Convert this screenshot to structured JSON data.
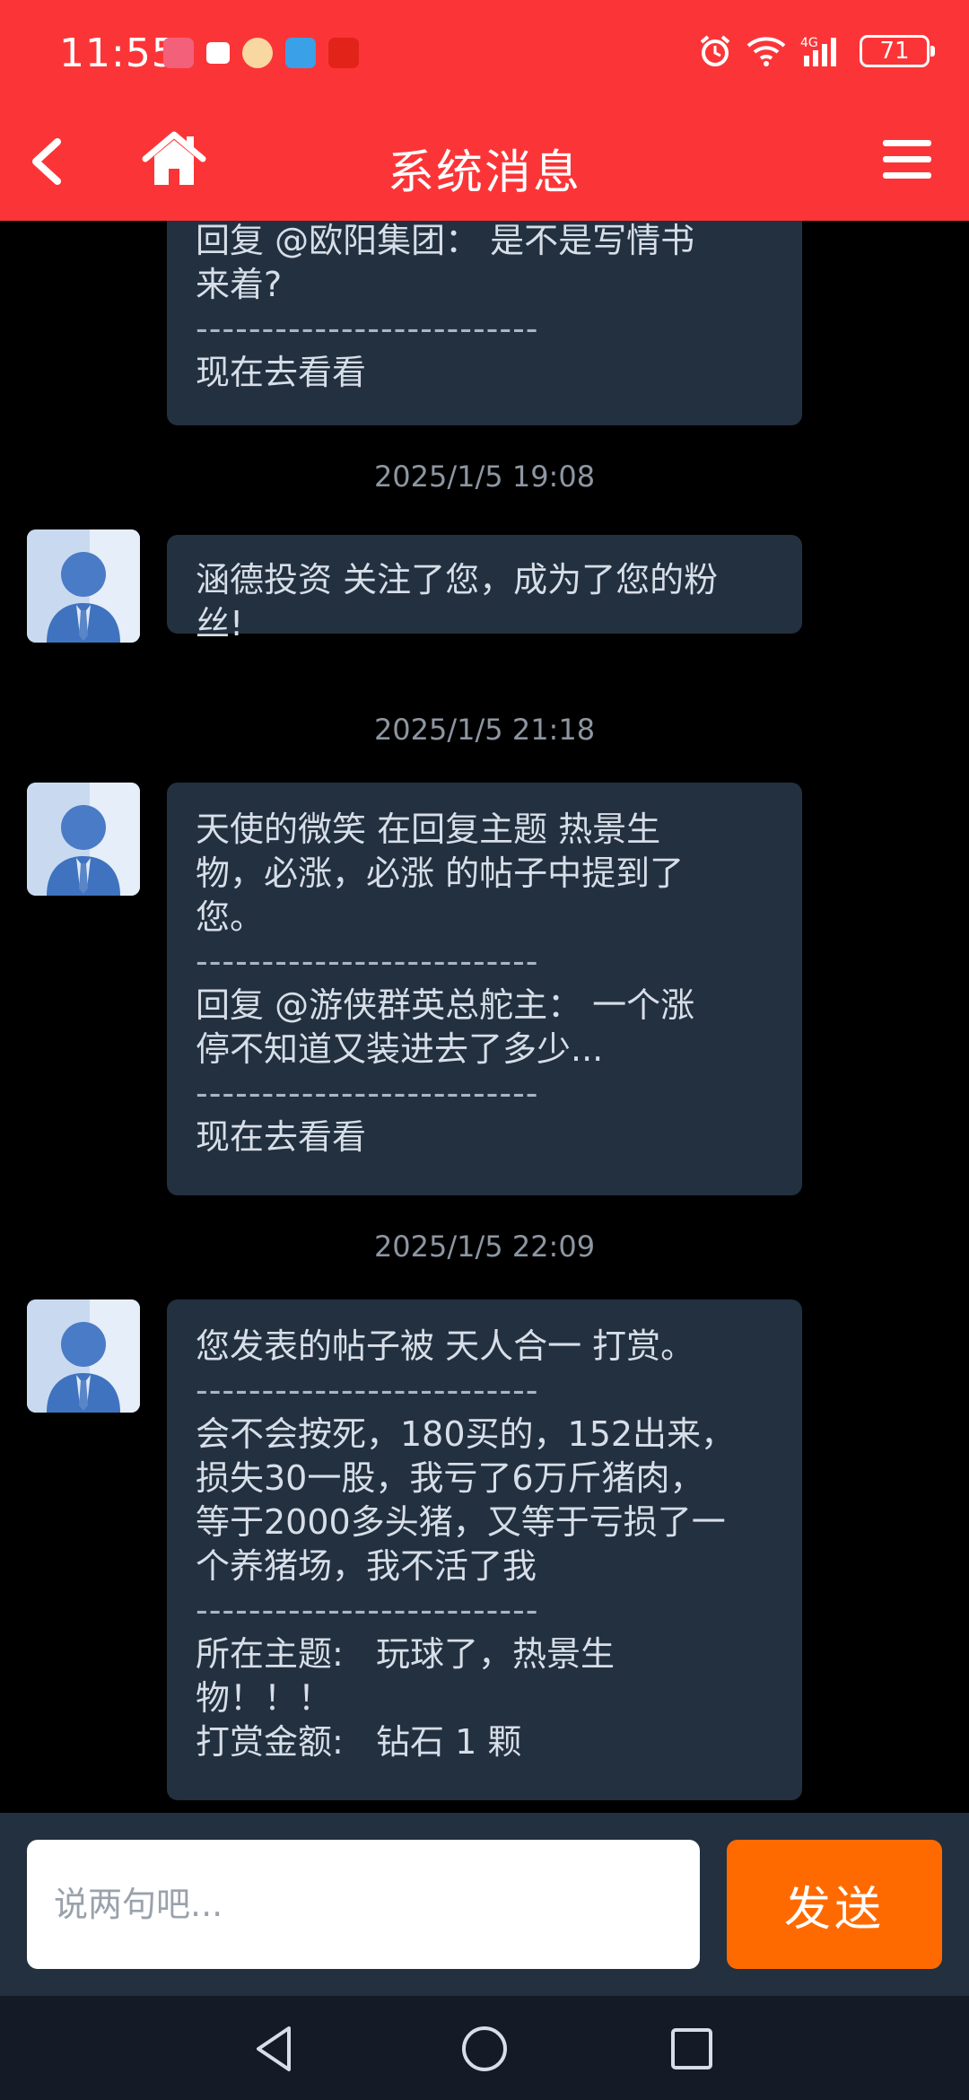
{
  "status_bar": {
    "time": "11:55",
    "battery": "71",
    "network": "4G",
    "notification_icons": [
      "huawei-app-icon",
      "message-icon",
      "mascot-app-icon",
      "browser-app-icon",
      "pinduoduo-app-icon"
    ]
  },
  "header": {
    "title": "系统消息",
    "background_color": "#fb3537"
  },
  "messages": [
    {
      "timestamp": "",
      "lines": [
        "回复 @欧阳集团： 是不是写情书",
        "来着?"
      ],
      "separator": "--------------------------",
      "link": "现在去看看"
    },
    {
      "timestamp": "2025/1/5 19:08",
      "lines": [
        "涵德投资 关注了您，成为了您的粉",
        "丝!"
      ]
    },
    {
      "timestamp": "2025/1/5 21:18",
      "lines": [
        "天使的微笑 在回复主题 热景生",
        "物，必涨，必涨 的帖子中提到了",
        "您。"
      ],
      "separator": "--------------------------",
      "reply": [
        "回复 @游侠群英总舵主： 一个涨",
        "停不知道又装进去了多少..."
      ],
      "link": "现在去看看"
    },
    {
      "timestamp": "2025/1/5 22:09",
      "lines": [
        "您发表的帖子被 天人合一 打赏。"
      ],
      "separator": "--------------------------",
      "content": [
        "会不会按死，180买的，152出来，",
        "损失30一股，我亏了6万斤猪肉，",
        "等于2000多头猪，又等于亏损了一",
        "个养猪场，我不活了我"
      ],
      "topic": [
        "所在主题:   玩球了，热景生",
        "物！！！"
      ],
      "reward": "打赏金额:   钻石 1 颗"
    }
  ],
  "composer": {
    "placeholder": "说两句吧...",
    "send_label": "发送",
    "send_color": "#ff6a00"
  }
}
